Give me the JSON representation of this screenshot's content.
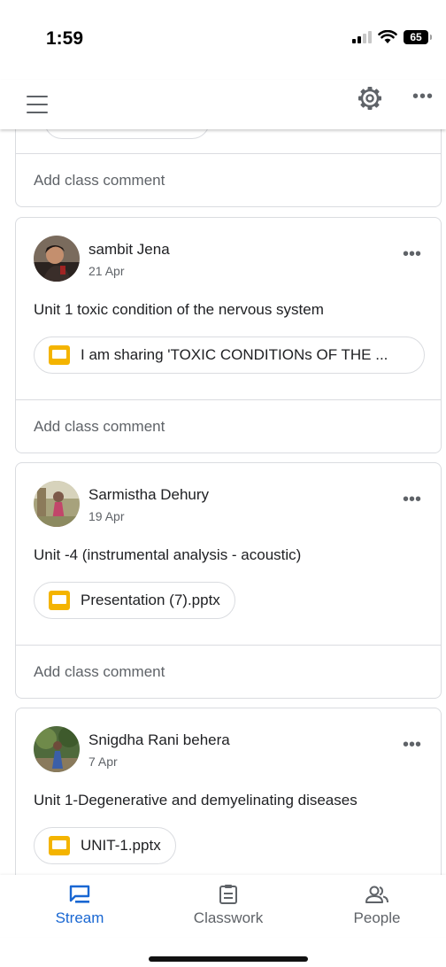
{
  "status_bar": {
    "time": "1:59",
    "battery": "65"
  },
  "feed": {
    "posts": [
      {
        "comment_placeholder": "Add class comment"
      },
      {
        "author": "sambit Jena",
        "date": "21 Apr",
        "text": "Unit 1 toxic condition of the nervous system",
        "attachment": "I am sharing 'TOXIC CONDITIONs OF THE ...",
        "comment_placeholder": "Add class comment"
      },
      {
        "author": "Sarmistha Dehury",
        "date": "19 Apr",
        "text": "Unit -4 (instrumental analysis - acoustic)",
        "attachment": "Presentation (7).pptx",
        "comment_placeholder": "Add class comment"
      },
      {
        "author": "Snigdha Rani behera",
        "date": "7 Apr",
        "text": "Unit 1-Degenerative and demyelinating diseases",
        "attachment": "UNIT-1.pptx"
      }
    ]
  },
  "bottom_nav": {
    "items": [
      {
        "label": "Stream",
        "icon": "stream-icon",
        "active": true
      },
      {
        "label": "Classwork",
        "icon": "classwork-icon",
        "active": false
      },
      {
        "label": "People",
        "icon": "people-icon",
        "active": false
      }
    ]
  },
  "colors": {
    "accent": "#1967d2",
    "slides_yellow": "#f4b400",
    "divider": "#dadce0"
  }
}
